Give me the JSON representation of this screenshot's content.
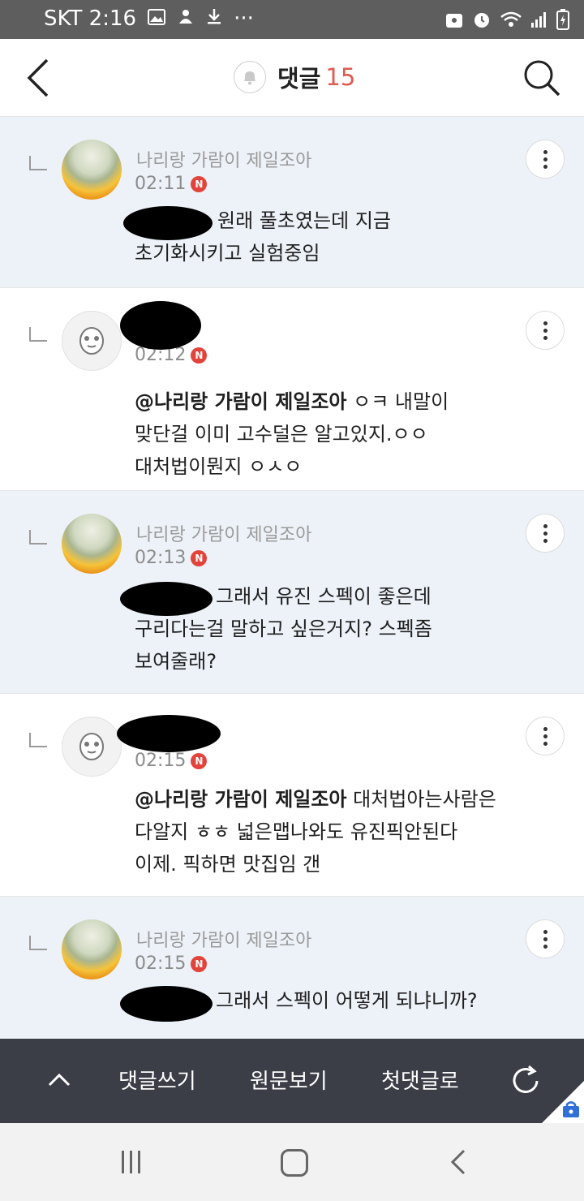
{
  "status_bar": {
    "carrier_time": "SKT 2:16",
    "more": "···",
    "left_icons": [
      "image-icon",
      "notification-icon",
      "download-icon"
    ],
    "right_icons": [
      "lock-icon",
      "alarm-icon",
      "wifi-icon",
      "signal-icon",
      "battery-charging-icon"
    ]
  },
  "header": {
    "title": "댓글",
    "count": "15"
  },
  "comments": [
    {
      "author": "나리랑 가람이 제일조아",
      "time": "02:11",
      "badge": "N",
      "mention": "",
      "lines": [
        "원래 풀초였는데 지금",
        "초기화시키고 실험중임"
      ]
    },
    {
      "author": "",
      "time": "02:12",
      "badge": "N",
      "mention": "@나리랑 가람이 제일조아",
      "first_rest": " ㅇㅋ 내말이",
      "lines": [
        "맞단걸 이미 고수덜은 알고있지.ㅇㅇ",
        "대처법이뭔지 ㅇㅅㅇ"
      ]
    },
    {
      "author": "나리랑 가람이 제일조아",
      "time": "02:13",
      "badge": "N",
      "mention": "",
      "lines": [
        "그래서 유진 스펙이 좋은데",
        "구리다는걸 말하고 싶은거지? 스펙좀",
        "보여줄래?"
      ]
    },
    {
      "author": "",
      "time": "02:15",
      "badge": "N",
      "mention": "@나리랑 가람이 제일조아",
      "first_rest": " 대처법아는사람은",
      "lines": [
        "다알지 ㅎㅎ 넓은맵나와도 유진픽안된다",
        "이제. 픽하면 맛집임 갠"
      ]
    },
    {
      "author": "나리랑 가람이 제일조아",
      "time": "02:15",
      "badge": "N",
      "mention": "",
      "lines": [
        "그래서 스펙이 어떻게 되냐니까?"
      ]
    }
  ],
  "toolbar": {
    "write": "댓글쓰기",
    "view_original": "원문보기",
    "first_comment": "첫댓글로"
  }
}
